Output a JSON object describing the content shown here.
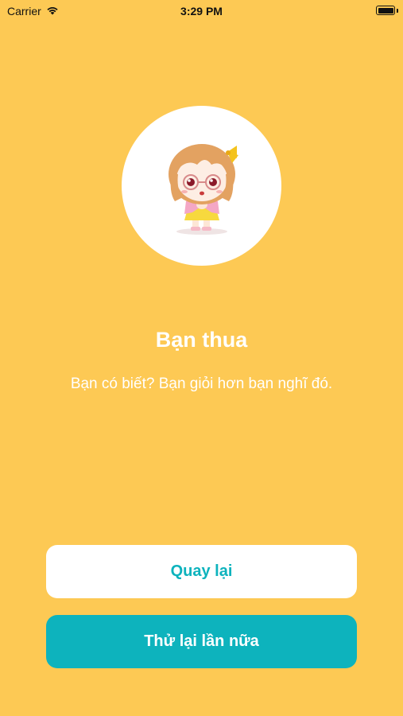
{
  "status_bar": {
    "carrier": "Carrier",
    "time": "3:29 PM",
    "wifi_icon": "wifi-icon",
    "battery_icon": "battery-icon"
  },
  "result": {
    "avatar_icon": "chibi-girl-praying-illustration",
    "title": "Bạn thua",
    "subtitle": "Bạn có biết? Bạn giỏi hơn bạn nghĩ đó."
  },
  "actions": {
    "back_label": "Quay lại",
    "retry_label": "Thử lại lần nữa"
  },
  "colors": {
    "background": "#FDC954",
    "accent": "#0DB3BD",
    "text_on_background": "#FFFFFF"
  }
}
